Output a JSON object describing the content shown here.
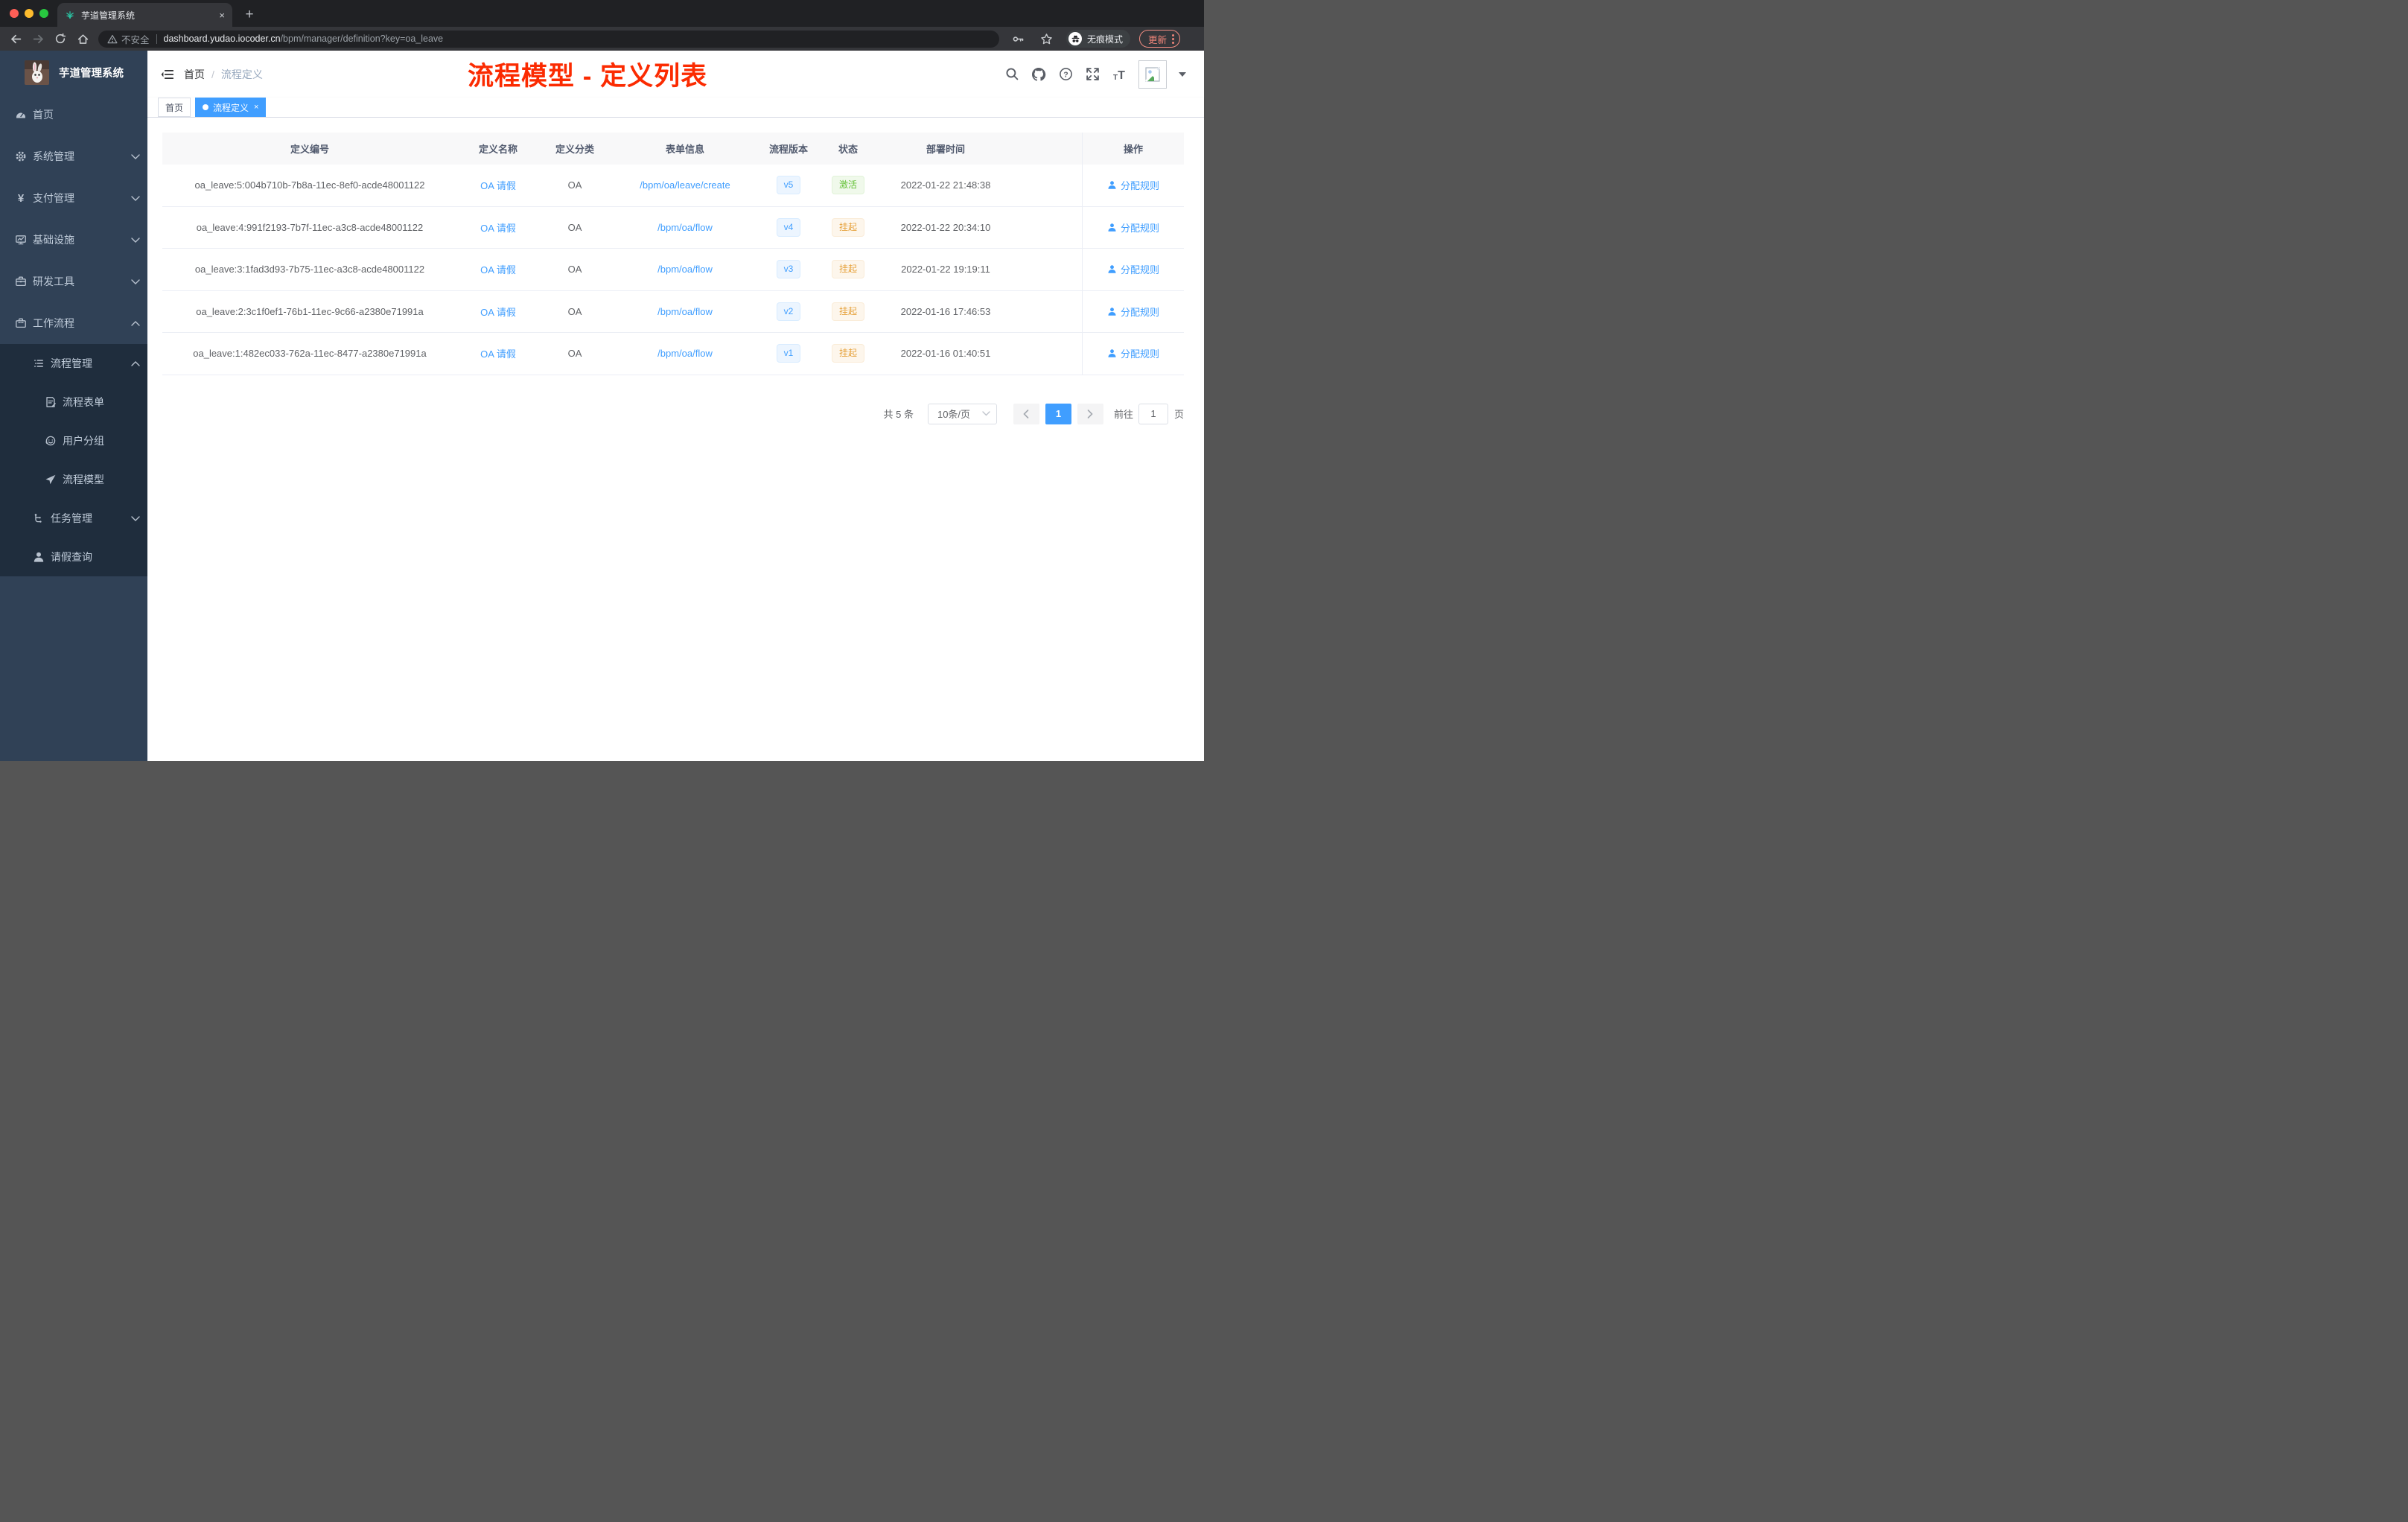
{
  "browser": {
    "tab_title": "芋道管理系统",
    "tab_close": "×",
    "new_tab": "+",
    "security_label": "不安全",
    "url_host": "dashboard.yudao.iocoder.cn",
    "url_path": "/bpm/manager/definition?key=oa_leave",
    "incognito_label": "无痕模式",
    "update_label": "更新"
  },
  "sidebar": {
    "logo_title": "芋道管理系统",
    "items": [
      {
        "key": "home",
        "label": "首页",
        "icon": "dashboard-icon",
        "level": 1,
        "chevron": null,
        "group": "top"
      },
      {
        "key": "system",
        "label": "系统管理",
        "icon": "gear-icon",
        "level": 1,
        "chevron": "down",
        "group": "top"
      },
      {
        "key": "payment",
        "label": "支付管理",
        "icon": "yen-icon",
        "level": 1,
        "chevron": "down",
        "group": "top"
      },
      {
        "key": "infra",
        "label": "基础设施",
        "icon": "monitor-icon",
        "level": 1,
        "chevron": "down",
        "group": "top"
      },
      {
        "key": "devtools",
        "label": "研发工具",
        "icon": "toolbox-icon",
        "level": 1,
        "chevron": "down",
        "group": "top"
      },
      {
        "key": "workflow",
        "label": "工作流程",
        "icon": "briefcase-icon",
        "level": 1,
        "chevron": "up",
        "group": "top"
      },
      {
        "key": "process-manage",
        "label": "流程管理",
        "icon": "list-icon",
        "level": 2,
        "chevron": "up",
        "group": "sub"
      },
      {
        "key": "process-form",
        "label": "流程表单",
        "icon": "form-icon",
        "level": 3,
        "chevron": null,
        "group": "sub"
      },
      {
        "key": "user-group",
        "label": "用户分组",
        "icon": "face-icon",
        "level": 3,
        "chevron": null,
        "group": "sub"
      },
      {
        "key": "process-model",
        "label": "流程模型",
        "icon": "plane-icon",
        "level": 3,
        "chevron": null,
        "group": "sub"
      },
      {
        "key": "task-manage",
        "label": "任务管理",
        "icon": "tree-icon",
        "level": 2,
        "chevron": "down",
        "group": "sub"
      },
      {
        "key": "leave-query",
        "label": "请假查询",
        "icon": "user-icon",
        "level": 2,
        "chevron": null,
        "group": "sub"
      }
    ]
  },
  "header": {
    "breadcrumb_home": "首页",
    "breadcrumb_separator": "/",
    "breadcrumb_current": "流程定义",
    "annotation": "流程模型 - 定义列表",
    "annotation_color": "#fb2b01"
  },
  "tags": [
    {
      "label": "首页",
      "active": false
    },
    {
      "label": "流程定义",
      "active": true,
      "close": "×"
    }
  ],
  "table": {
    "columns": [
      "定义编号",
      "定义名称",
      "定义分类",
      "表单信息",
      "流程版本",
      "状态",
      "部署时间",
      "操作"
    ],
    "action_label": "分配规则",
    "rows": [
      {
        "id": "oa_leave:5:004b710b-7b8a-11ec-8ef0-acde48001122",
        "name": "OA 请假",
        "category": "OA",
        "form": "/bpm/oa/leave/create",
        "version": "v5",
        "status": "激活",
        "status_type": "success",
        "deploy_time": "2022-01-22 21:48:38"
      },
      {
        "id": "oa_leave:4:991f2193-7b7f-11ec-a3c8-acde48001122",
        "name": "OA 请假",
        "category": "OA",
        "form": "/bpm/oa/flow",
        "version": "v4",
        "status": "挂起",
        "status_type": "warning",
        "deploy_time": "2022-01-22 20:34:10"
      },
      {
        "id": "oa_leave:3:1fad3d93-7b75-11ec-a3c8-acde48001122",
        "name": "OA 请假",
        "category": "OA",
        "form": "/bpm/oa/flow",
        "version": "v3",
        "status": "挂起",
        "status_type": "warning",
        "deploy_time": "2022-01-22 19:19:11"
      },
      {
        "id": "oa_leave:2:3c1f0ef1-76b1-11ec-9c66-a2380e71991a",
        "name": "OA 请假",
        "category": "OA",
        "form": "/bpm/oa/flow",
        "version": "v2",
        "status": "挂起",
        "status_type": "warning",
        "deploy_time": "2022-01-16 17:46:53"
      },
      {
        "id": "oa_leave:1:482ec033-762a-11ec-8477-a2380e71991a",
        "name": "OA 请假",
        "category": "OA",
        "form": "/bpm/oa/flow",
        "version": "v1",
        "status": "挂起",
        "status_type": "warning",
        "deploy_time": "2022-01-16 01:40:51"
      }
    ]
  },
  "pagination": {
    "total_label": "共 5 条",
    "page_size": "10条/页",
    "current_page": "1",
    "goto_label": "前往",
    "goto_value": "1",
    "page_unit": "页"
  },
  "colors": {
    "accent": "#409eff",
    "status_active": "#67c23a",
    "status_suspended": "#e6a23c",
    "sidebar_bg": "#304156",
    "submenu_bg": "#1f2d3d"
  }
}
